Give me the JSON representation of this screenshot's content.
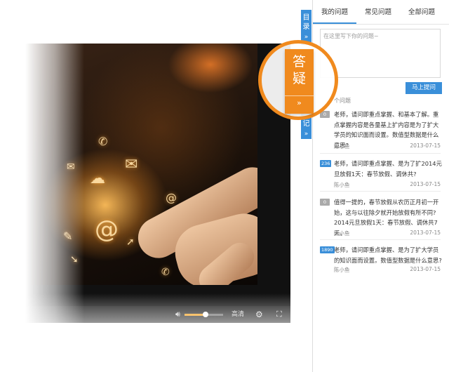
{
  "tabs": [
    {
      "label": "我的问题"
    },
    {
      "label": "常见问题"
    },
    {
      "label": "全部问题"
    }
  ],
  "ask": {
    "placeholder": "在这里写下你的问题~",
    "submit_label": "马上提问"
  },
  "list_header": "个问题",
  "questions": [
    {
      "count": "0",
      "text": "老师，请问即重点掌握、和基本了解。重点掌握内容是各量基上扩内容是为了扩大学员的知识面而设置。数值型数据是什么意思?",
      "author": "陈小鱼",
      "date": "2013-07-15"
    },
    {
      "count": "236",
      "text": "老师，请问即重点掌握、是为了扩2014元旦放假1天：春节放假、调休共?",
      "author": "陈小鱼",
      "date": "2013-07-15"
    },
    {
      "count": "0",
      "text": "值得一提的，春节放假从农历正月初一开始，这与以往除夕就开始放假有所不同?2014元旦放假1天：春节放假、调休共7天。",
      "author": "陈小鱼",
      "date": "2013-07-15"
    },
    {
      "count": "1890",
      "text": "老师，请问即重点掌握、是为了扩大学员的知识面而设置。数值型数据是什么意思?",
      "author": "陈小鱼",
      "date": "2013-07-15"
    }
  ],
  "side_tabs": {
    "catalog": {
      "label": "目录",
      "arrow": "»"
    },
    "answer": {
      "label": "答疑",
      "arrow": "»"
    },
    "notes": {
      "label": "笔记",
      "arrow": "»"
    }
  },
  "player": {
    "quality_label": "高清",
    "volume_level": 0.55
  },
  "colors": {
    "accent": "#3a8fd9",
    "highlight": "#f08a1e"
  }
}
